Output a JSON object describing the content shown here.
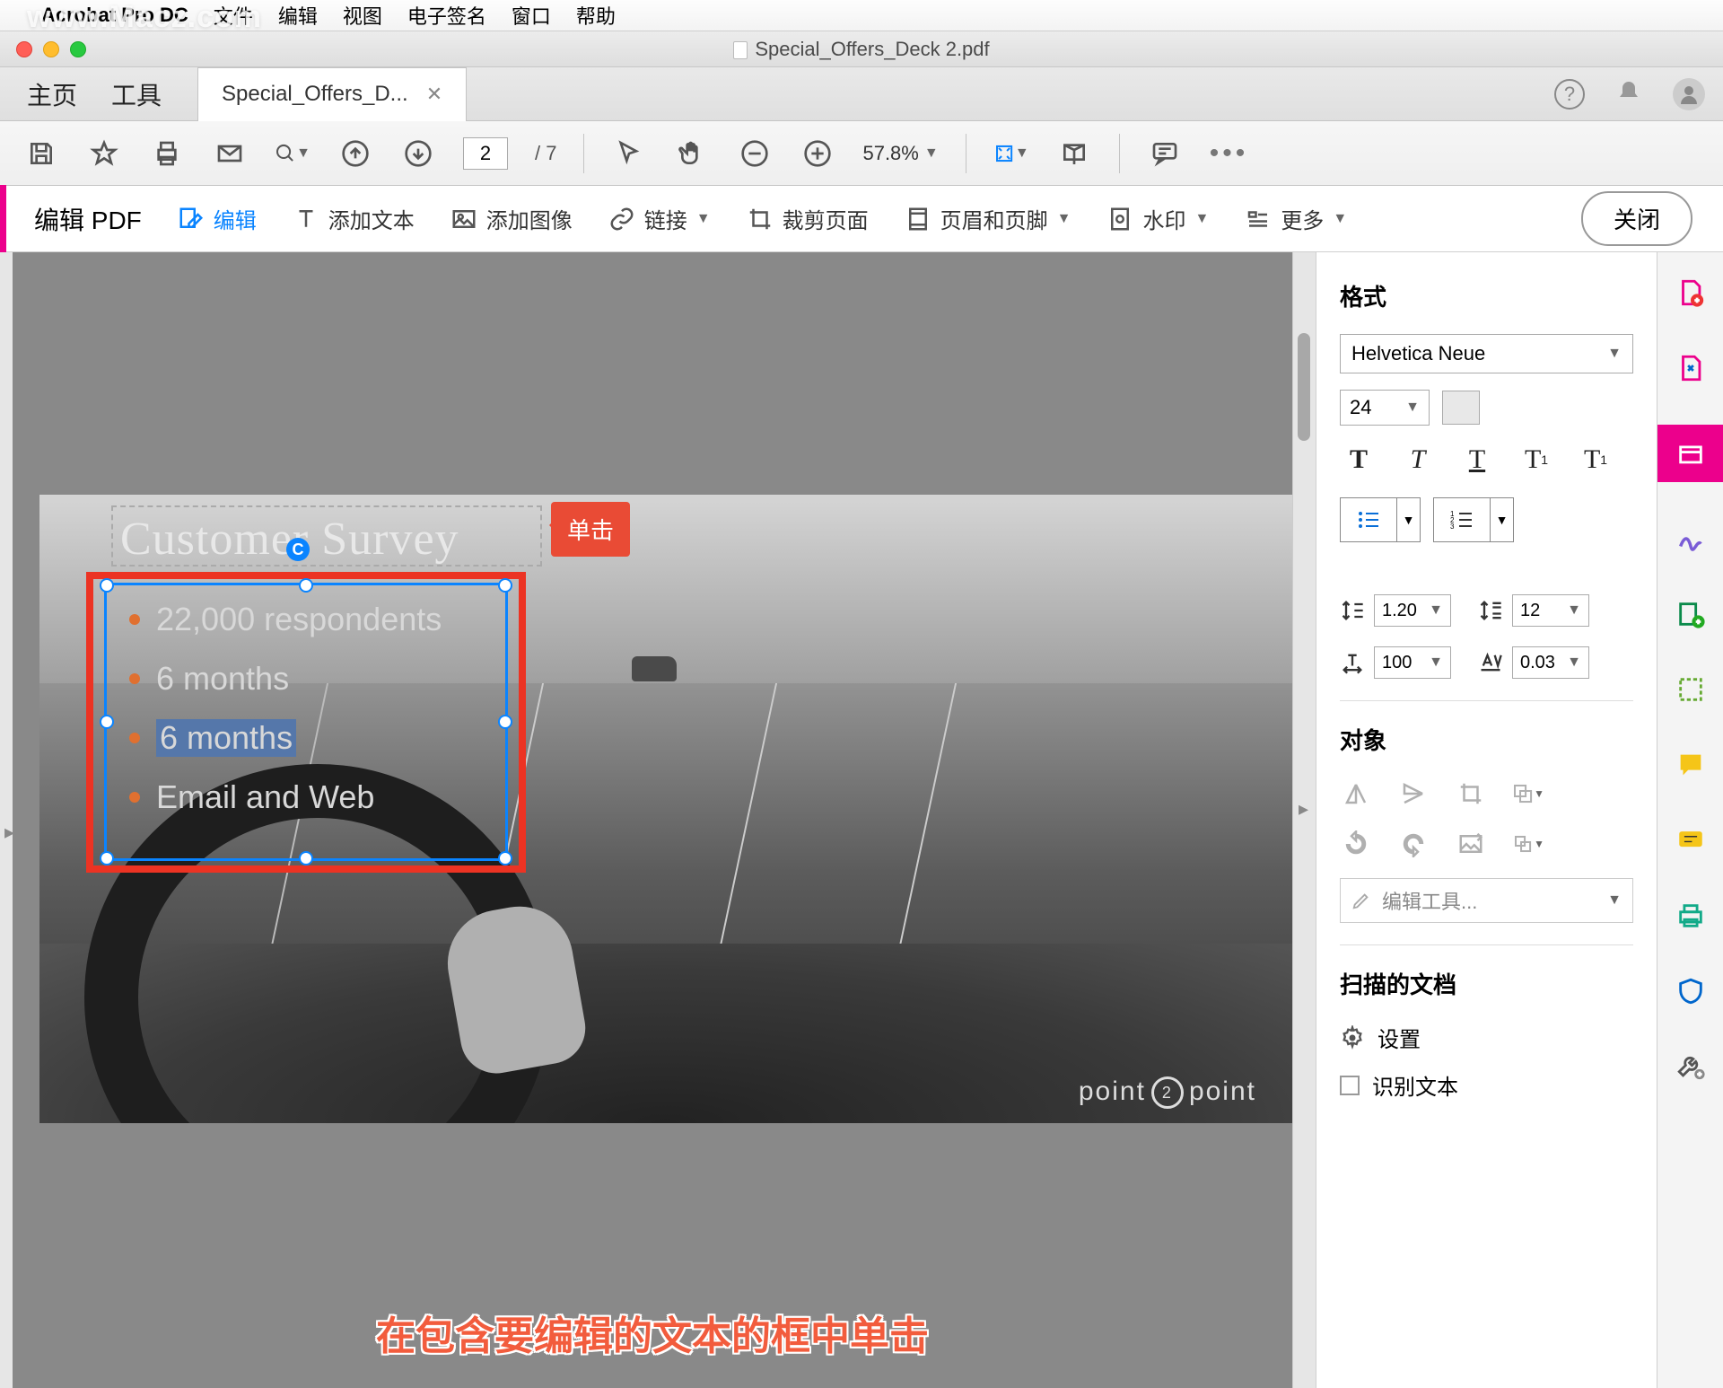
{
  "mac_menu": {
    "app": "Acrobat Pro DC",
    "items": [
      "文件",
      "编辑",
      "视图",
      "电子签名",
      "窗口",
      "帮助"
    ]
  },
  "watermark": "www.Macz.com",
  "title": "Special_Offers_Deck 2.pdf",
  "tabs": {
    "home": "主页",
    "tools": "工具",
    "file": "Special_Offers_D..."
  },
  "toolbar": {
    "page_current": "2",
    "page_total": "/ 7",
    "zoom": "57.8%"
  },
  "edit_toolbar": {
    "title": "编辑 PDF",
    "edit": "编辑",
    "add_text": "添加文本",
    "add_image": "添加图像",
    "link": "链接",
    "crop": "裁剪页面",
    "header": "页眉和页脚",
    "watermark": "水印",
    "more": "更多",
    "close": "关闭"
  },
  "page": {
    "heading": "Customer Survey",
    "bullets": [
      "22,000 respondents",
      "6 months",
      "6 months",
      "Email and Web"
    ],
    "brand_left": "point",
    "brand_right": "point"
  },
  "annot": {
    "tag": "单击",
    "bottom": "在包含要编辑的文本的框中单击"
  },
  "fmt": {
    "title": "格式",
    "font": "Helvetica Neue",
    "size": "24",
    "line_spacing": "1.20",
    "para_spacing": "12",
    "h_scale": "100",
    "char_spacing": "0.03",
    "obj_title": "对象",
    "edit_tool": "编辑工具...",
    "scan_title": "扫描的文档",
    "settings": "设置",
    "recognize": "识别文本"
  }
}
